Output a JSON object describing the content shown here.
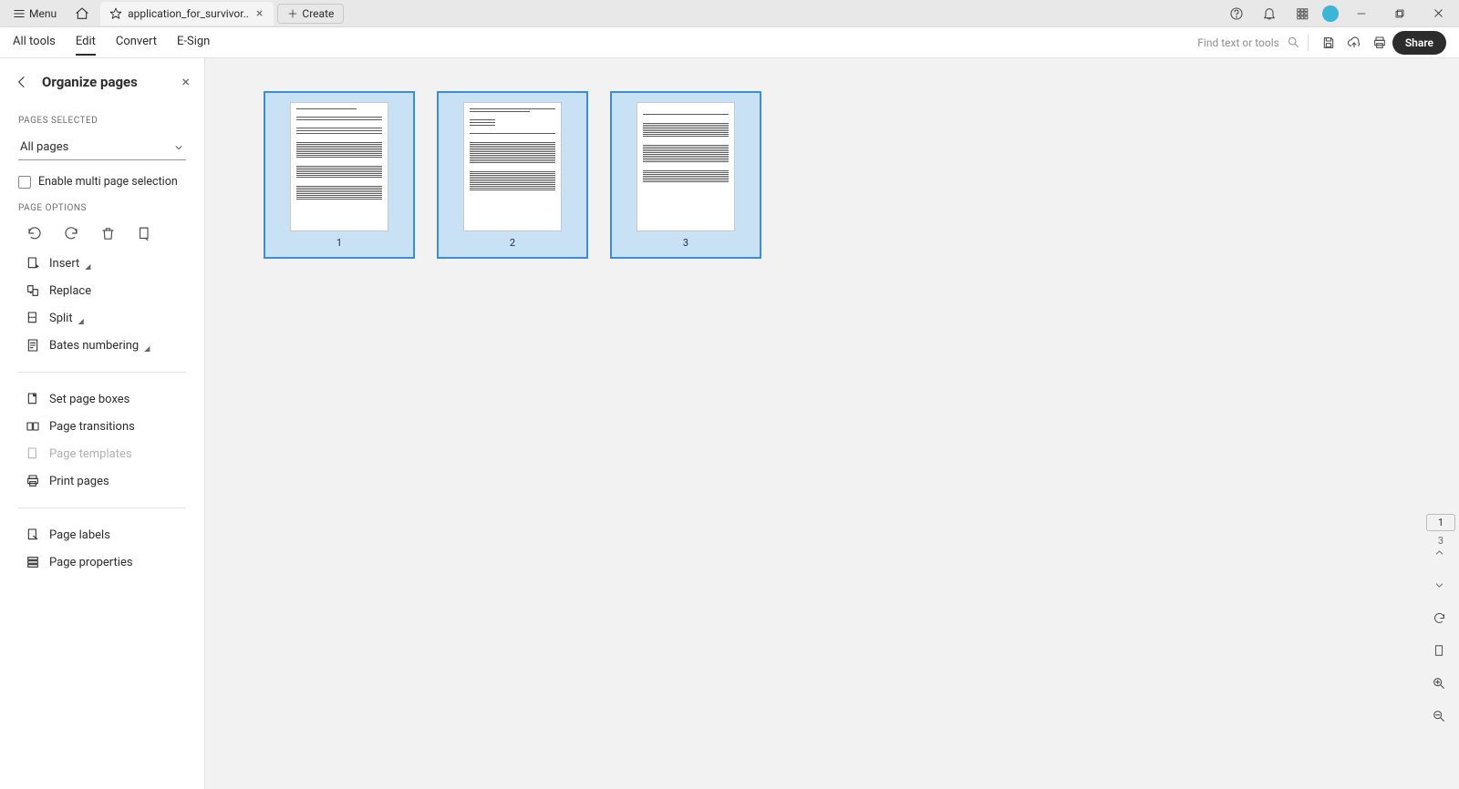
{
  "titlebar": {
    "menu_label": "Menu",
    "tab_title": "application_for_survivor..",
    "create_label": "Create"
  },
  "toolbar": {
    "tabs": {
      "all_tools": "All tools",
      "edit": "Edit",
      "convert": "Convert",
      "esign": "E-Sign"
    },
    "find_placeholder": "Find text or tools",
    "share_label": "Share"
  },
  "sidebar": {
    "title": "Organize pages",
    "section_pages_selected": "Pages Selected",
    "select_value": "All pages",
    "enable_multi": "Enable multi page selection",
    "section_page_options": "Page Options",
    "items": {
      "insert": "Insert",
      "replace": "Replace",
      "split": "Split",
      "bates": "Bates numbering",
      "set_page_boxes": "Set page boxes",
      "page_transitions": "Page transitions",
      "page_templates": "Page templates",
      "print_pages": "Print pages",
      "page_labels": "Page labels",
      "page_properties": "Page properties"
    }
  },
  "pages": {
    "p1": "1",
    "p2": "2",
    "p3": "3"
  },
  "right_rail": {
    "current_page": "1",
    "total_pages": "3"
  }
}
